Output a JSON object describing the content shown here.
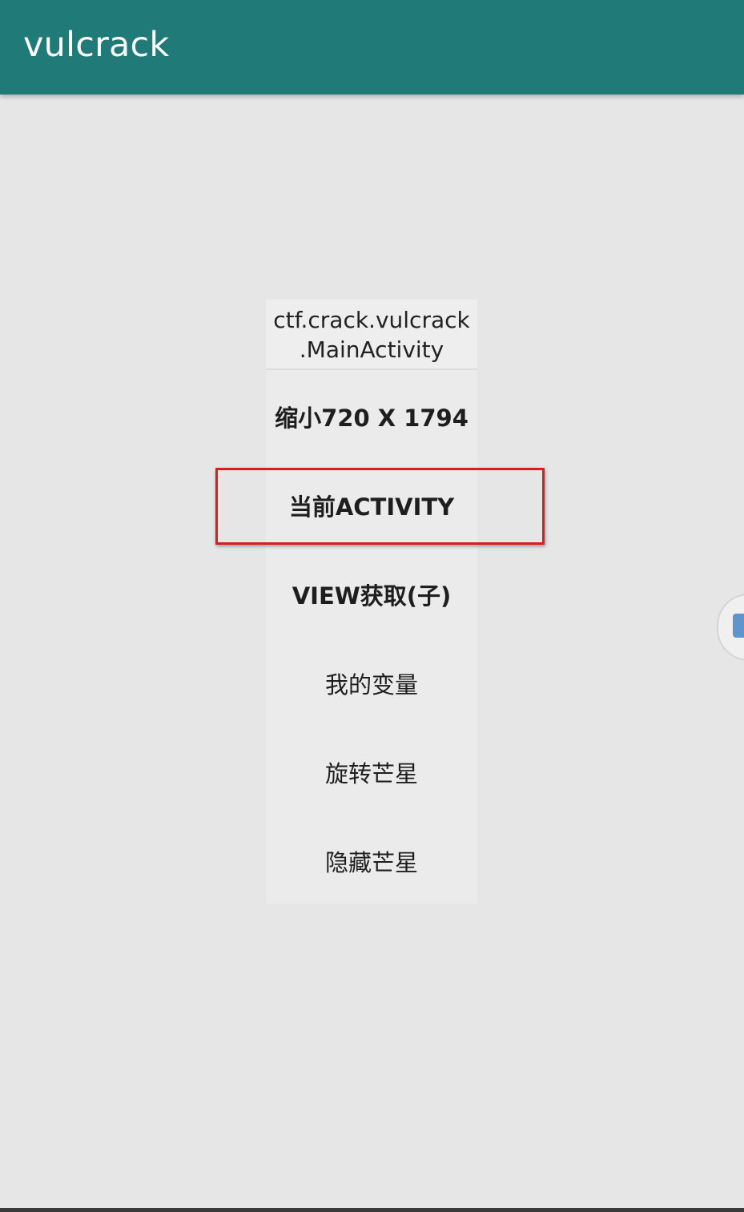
{
  "app_bar": {
    "title": "vulcrack",
    "color": "#1f7a78"
  },
  "menu": {
    "header": {
      "line1": "ctf.crack.vulcrack",
      "line2": ".MainActivity"
    },
    "items": [
      {
        "label": "缩小720 X 1794"
      },
      {
        "label": "当前ACTIVITY"
      },
      {
        "label": "VIEW获取(子)"
      },
      {
        "label": "我的变量"
      },
      {
        "label": "旋转芒星"
      },
      {
        "label": "隐藏芒星"
      }
    ]
  },
  "highlight": {
    "color": "#e01b1b"
  },
  "floating_button": {
    "icon": "cube-icon"
  }
}
